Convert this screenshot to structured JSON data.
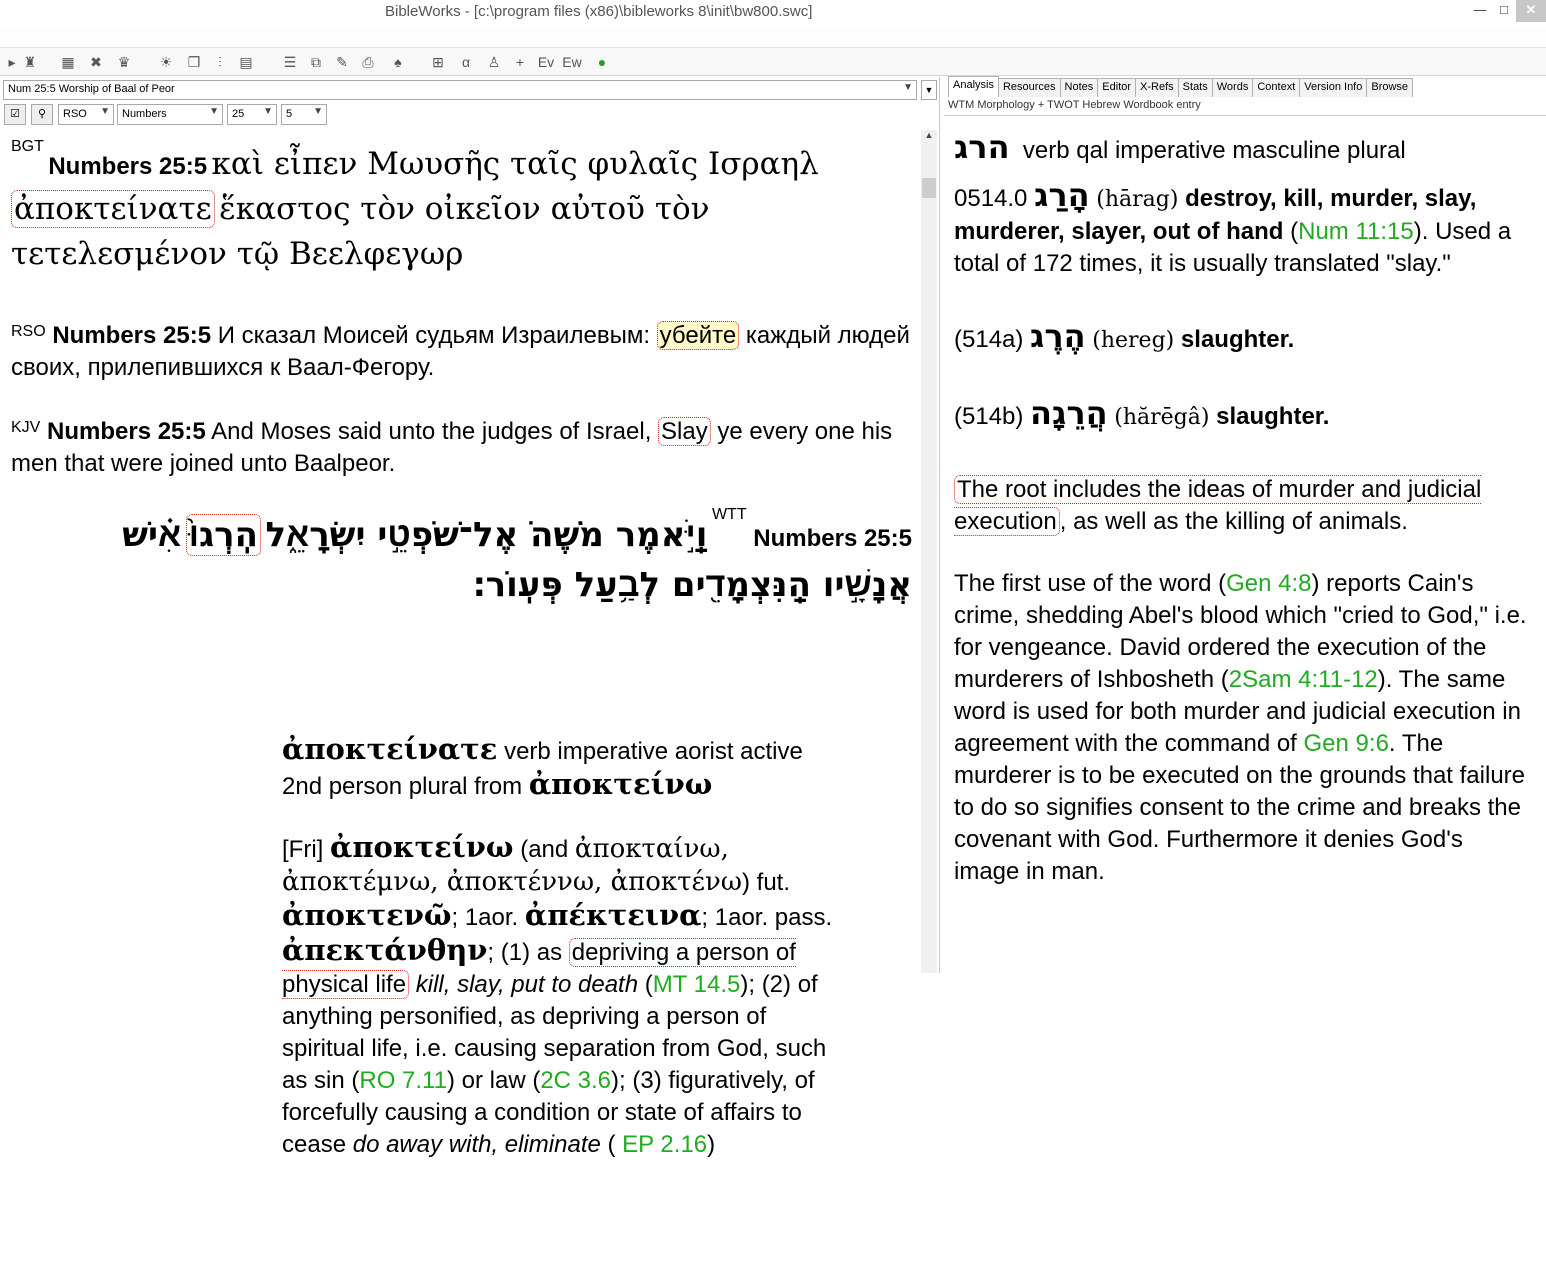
{
  "window": {
    "title": "BibleWorks - [c:\\program files (x86)\\bibleworks 8\\init\\bw800.swc]",
    "min_label": "―",
    "max_label": "□",
    "close_label": "✕"
  },
  "toolbar_icons": [
    "dropdown-icon",
    "book-icon",
    "filter-icon",
    "search-icon",
    "sun-icon",
    "window-icon",
    "columns-icon",
    "grid-icon",
    "list-icon",
    "copy-icon",
    "edit-icon",
    "print-icon",
    "tree-icon",
    "layout-icon",
    "text-icon",
    "user-icon",
    "plus-icon",
    "ev-icon",
    "ew-icon",
    "globe-icon"
  ],
  "left": {
    "verse_select": "Num 25:5 Worship of Baal of Peor",
    "version_combo": "RSO",
    "book_combo": "Numbers",
    "chapter_combo": "25",
    "verse_combo": "5",
    "bgt": {
      "tag": "BGT",
      "ref": "Numbers 25:5",
      "text1": "καὶ εἶπεν Μωυσῆς ταῖς φυλαῖς Ισραηλ",
      "highlight": "ἀποκτείνατε",
      "text2": "ἕκαστος τὸν οἰκεῖον αὐτοῦ τὸν τετελεσμένον τῷ Βεελφεγωρ"
    },
    "rso": {
      "tag": "RSO",
      "ref": "Numbers 25:5",
      "text1": "И сказал Моисей судьям Израилевым:",
      "highlight": "убейте",
      "text2": "каждый людей своих, прилепившихся к Ваал-Фегору."
    },
    "kjv": {
      "tag": "KJV",
      "ref": "Numbers 25:5",
      "text1": "And Moses said unto the judges of Israel,",
      "highlight": "Slay",
      "text2": "ye every one his men that were joined unto Baalpeor."
    },
    "wtt": {
      "tag": "WTT",
      "ref": "Numbers 25:5",
      "text1": "וַֽיֹּ֣אמֶר מֹשֶׁהֺ אֶל־שֹׁפְטֵ֣י יִשְׂרָאֵ֑ל",
      "highlight": "הִֽרְגוּ֙",
      "text2": "אִ֗ישׁ אֲנָשָׁ֣יו הַֽנִּצְמָדִ֖ים לְבַ֥עַל פְּעֽוֹר׃"
    },
    "popup": {
      "word": "ἀποκτείνατε",
      "parse": "verb imperative aorist active 2nd person plural from",
      "lemma": "ἀποκτείνω",
      "fri_tag": "[Fri]",
      "fri_lemma": "ἀποκτείνω",
      "alt_open": "(and",
      "alt_forms": "ἀποκταίνω, ἀποκτέμνω, ἀποκτέννω, ἀποκτένω",
      "fut_label": ") fut.",
      "fut_form": "ἀποκτενῶ",
      "aor_label": "; 1aor.",
      "aor_form": "ἀπέκτεινα",
      "pass_label": "; 1aor. pass.",
      "pass_form": "ἀπεκτάνθην",
      "def1_pre": "; (1) as",
      "def1_box": "depriving a person of physical life",
      "def1_gloss": "kill, slay, put to death",
      "ref1": "MT 14.5",
      "def2_pre": "); (2) of anything personified, as depriving a person of spiritual life, i.e. causing separation from God, such as sin (",
      "ref2": "RO 7.11",
      "def2_mid": ") or law (",
      "ref3": "2C 3.6",
      "def3_pre": "); (3) figuratively, of forcefully causing a condition or state of affairs to cease",
      "def3_gloss": "do away with, eliminate",
      "ref4": "EP 2.16",
      "close_paren": ")"
    }
  },
  "right": {
    "tabs": [
      "Analysis",
      "Resources",
      "Notes",
      "Editor",
      "X-Refs",
      "Stats",
      "Words",
      "Context",
      "Version Info",
      "Browse"
    ],
    "active_tab": "Analysis",
    "subtitle": "WTM Morphology + TWOT Hebrew Wordbook entry",
    "head_word": "הרג",
    "head_parse": "verb qal imperative masculine plural",
    "entry_num": "0514.0",
    "entry_word": "הָרַג",
    "entry_translit": "(hārag)",
    "entry_gloss": "destroy, kill, murder, slay, murderer, slayer, out of hand",
    "entry_ref": "Num 11:15",
    "entry_usage": "). Used a total of 172 times, it is usually translated \"slay.\"",
    "sub_a_num": "(514a)",
    "sub_a_word": "הֶרֶג",
    "sub_a_translit": "(hereg)",
    "sub_a_gloss": "slaughter.",
    "sub_b_num": "(514b)",
    "sub_b_word": "הֲרֵגָה",
    "sub_b_translit": "(hărēgâ)",
    "sub_b_gloss": "slaughter.",
    "root_box": "The root includes the ideas of murder and judicial execution",
    "root_rest": ", as well as the killing of animals.",
    "para_pre": "The first use of the word (",
    "ref_gen48": "Gen 4:8",
    "para_mid1": ") reports Cain's crime, shedding Abel's blood which \"cried to God,\" i.e. for vengeance. David ordered the execution of the murderers of Ishbosheth (",
    "ref_2sam": "2Sam 4:11-12",
    "para_mid2": "). The same word is used for both murder and judicial execution in agreement with the command of",
    "ref_gen96": "Gen 9:6",
    "para_end": ". The murderer is to be executed on the grounds that failure to do so signifies consent to the crime and breaks the covenant with God. Furthermore it denies God's image in man."
  }
}
